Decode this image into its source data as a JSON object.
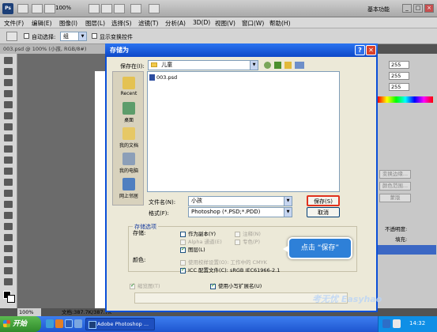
{
  "ps": {
    "logo": "Ps",
    "zoom": "100%",
    "workspace": "基本功能",
    "menu": [
      "文件(F)",
      "编辑(E)",
      "图像(I)",
      "图层(L)",
      "选择(S)",
      "滤镜(T)",
      "分析(A)",
      "3D(D)",
      "视图(V)",
      "窗口(W)",
      "帮助(H)"
    ],
    "options": {
      "auto_select_label": "自动选择:",
      "auto_select_value": "组",
      "show_transform_label": "显示变换控件"
    },
    "doc_tab": "003.psd @ 100% (小孩, RGB/8#)",
    "rgb": [
      "255",
      "255",
      "255"
    ],
    "panel_buttons": [
      "变换边缘...",
      "颜色范围...",
      "蒙版"
    ],
    "opacity_label": "不透明度:",
    "fill_label": "填充:",
    "status_zoom": "100%",
    "status_doc": "文档:387.7K/387.7K"
  },
  "dialog": {
    "title": "存储为",
    "help": "?",
    "close": "✕",
    "save_in_label": "保存在(I):",
    "save_in_value": "儿童",
    "places": [
      "Recent",
      "桌面",
      "我的文档",
      "我的电脑",
      "网上邻居"
    ],
    "file_name_label": "文件名(N):",
    "file_name_value": "小孩",
    "format_label": "格式(F):",
    "format_value": "Photoshop (*.PSD;*.PDD)",
    "save_button": "保存(S)",
    "cancel_button": "取消",
    "files": [
      "003.psd"
    ],
    "storage_options_title": "存储选项",
    "storage_label": "存储:",
    "as_copy": "作为副本(Y)",
    "notes": "注释(N)",
    "alpha": "Alpha 通道(E)",
    "spot": "专色(P)",
    "layers": "图层(L)",
    "color_label": "颜色:",
    "use_proof": "使用校样设置(O):",
    "proof_value": "工作中的 CMYK",
    "icc": "ICC 配置文件(C):",
    "icc_value": "sRGB IEC61966-2.1",
    "thumbnail": "缩览图(T)",
    "lowercase_ext": "使用小写扩展名(U)"
  },
  "callout": "点击 “保存”",
  "watermark": "考无忧 Easyhao",
  "taskbar": {
    "start": "开始",
    "task_ps": "Adobe Photoshop ...",
    "clock": "14:32"
  }
}
